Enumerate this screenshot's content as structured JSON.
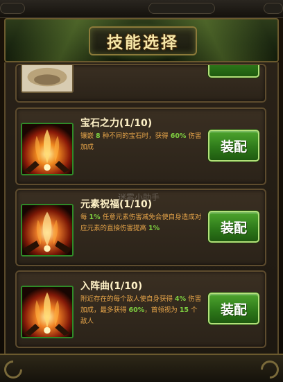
{
  "header": {
    "title": "技能选择"
  },
  "watermark": "迷雾小助手",
  "skills": [
    {
      "name": "宝石之力(1/10)",
      "desc": [
        {
          "t": "镶嵌 ",
          "k": "text"
        },
        {
          "t": "8",
          "k": "num"
        },
        {
          "t": " 种不同的宝石时，获得 ",
          "k": "text"
        },
        {
          "t": "60%",
          "k": "num"
        },
        {
          "t": " 伤害加成",
          "k": "text"
        }
      ],
      "button": "装配"
    },
    {
      "name": "元素祝福(1/10)",
      "desc": [
        {
          "t": "每 ",
          "k": "text"
        },
        {
          "t": "1%",
          "k": "num"
        },
        {
          "t": " 任意元素伤害减免会使自身造成对应元素的直接伤害提高 ",
          "k": "text"
        },
        {
          "t": "1%",
          "k": "num"
        }
      ],
      "button": "装配"
    },
    {
      "name": "入阵曲(1/10)",
      "desc": [
        {
          "t": "附近存在的每个敌人使自身获得 ",
          "k": "text"
        },
        {
          "t": "4%",
          "k": "num"
        },
        {
          "t": " 伤害加成，最多获得 ",
          "k": "text"
        },
        {
          "t": "60%",
          "k": "num"
        },
        {
          "t": "，首领视为 ",
          "k": "text"
        },
        {
          "t": "15",
          "k": "num"
        },
        {
          "t": " 个敌人",
          "k": "text"
        }
      ],
      "button": "装配"
    }
  ],
  "icons": {
    "skill": "flame-burst-icon",
    "partial": "crest-icon"
  }
}
